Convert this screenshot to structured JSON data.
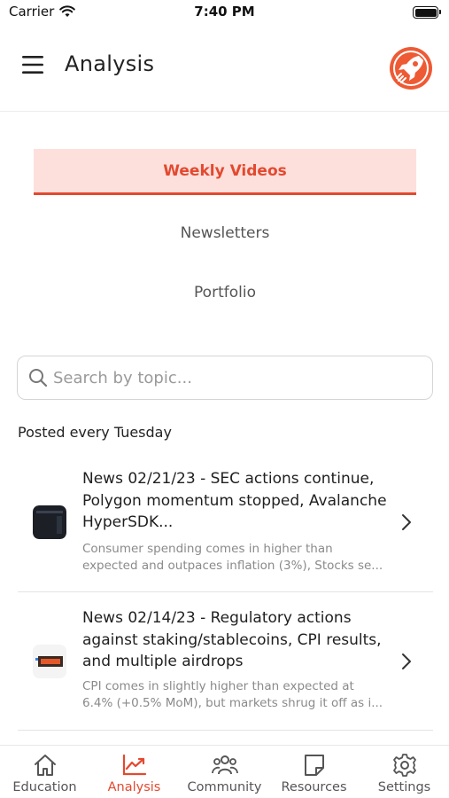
{
  "status_bar": {
    "carrier": "Carrier",
    "time": "7:40 PM"
  },
  "header": {
    "title": "Analysis"
  },
  "tabs": [
    {
      "label": "Weekly Videos",
      "active": true
    },
    {
      "label": "Newsletters",
      "active": false
    },
    {
      "label": "Portfolio",
      "active": false
    }
  ],
  "search": {
    "placeholder": "Search by topic...",
    "value": ""
  },
  "caption": "Posted every Tuesday",
  "items": [
    {
      "title": "News 02/21/23 - SEC actions continue, Polygon momentum stopped, Avalanche HyperSDK...",
      "description": "Consumer spending comes in higher than expected and outpaces inflation (3%), Stocks se..."
    },
    {
      "title": "News 02/14/23 - Regulatory actions against staking/stablecoins, CPI results, and multiple airdrops",
      "description": "CPI comes in slightly higher than expected at 6.4% (+0.5% MoM), but markets shrug it off as i..."
    }
  ],
  "bottom_nav": [
    {
      "label": "Education",
      "icon": "home-icon",
      "active": false
    },
    {
      "label": "Analysis",
      "icon": "chart-line-icon",
      "active": true
    },
    {
      "label": "Community",
      "icon": "people-icon",
      "active": false
    },
    {
      "label": "Resources",
      "icon": "note-icon",
      "active": false
    },
    {
      "label": "Settings",
      "icon": "gear-icon",
      "active": false
    }
  ],
  "colors": {
    "accent": "#e3492f",
    "active_tab_bg": "#fde0dc"
  }
}
